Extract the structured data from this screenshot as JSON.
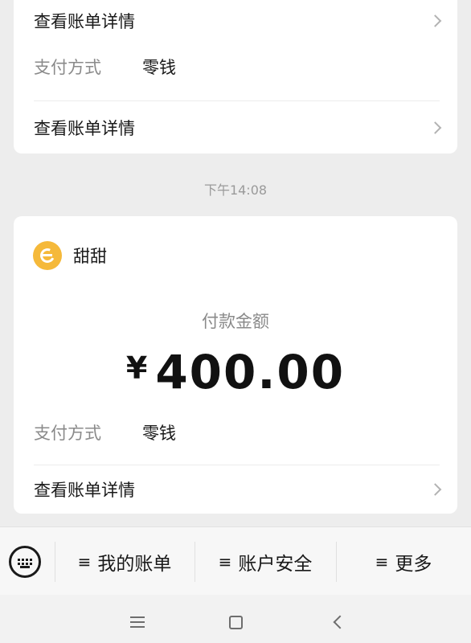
{
  "top_card": {
    "detail_link_1": "查看账单详情",
    "pay_method_label": "支付方式",
    "pay_method_value": "零钱",
    "detail_link_2": "查看账单详情"
  },
  "timestamp": "下午14:08",
  "payment_card": {
    "merchant_name": "甜甜",
    "amount_label": "付款金额",
    "currency_symbol": "¥",
    "amount": "400.00",
    "pay_method_label": "支付方式",
    "pay_method_value": "零钱",
    "detail_link": "查看账单详情"
  },
  "menu": {
    "items": [
      {
        "label": "我的账单"
      },
      {
        "label": "账户安全"
      },
      {
        "label": "更多"
      }
    ],
    "menu_glyph": "≡"
  },
  "colors": {
    "background": "#ededed",
    "card": "#ffffff",
    "secondary_text": "#8a8a8a",
    "logo": "#f5b93a"
  },
  "icons": {
    "keyboard": "keyboard-icon",
    "chevron": "chevron-right-icon",
    "logo": "merchant-logo-icon"
  }
}
